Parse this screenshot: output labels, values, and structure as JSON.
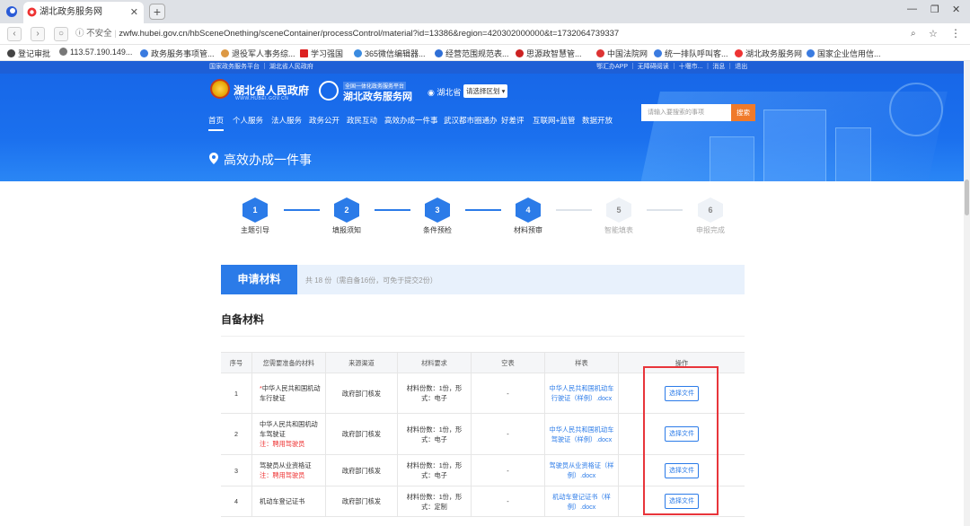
{
  "browser": {
    "tab_title": "湖北政务服务网",
    "address": "zwfw.hubei.gov.cn/hbSceneOnething/sceneContainer/processControl/material?id=13386&region=420302000000&t=1732064739337",
    "security": "不安全",
    "bookmarks": [
      "登记审批",
      "113.57.190.149...",
      "政务服务事项管...",
      "退役军人事务综...",
      "学习强国",
      "365微信编辑器...",
      "经营范围规范表...",
      "思源政智慧管...",
      "中国法院网",
      "统一排队呼叫客...",
      "湖北政务服务网",
      "国家企业信用信..."
    ]
  },
  "site": {
    "top_left": "国家政务服务平台 ｜ 湖北省人民政府",
    "top_right": "鄂汇办APP ｜ 无障碍阅读 ｜ 十堰市... ｜ 消息 ｜ 退出",
    "gov_title": "湖北省人民政府",
    "gov_sub": "WWW.HUBEI.GOV.CN",
    "svc_small": "全国一体化政务服务平台",
    "svc_title": "湖北政务服务网",
    "province": "湖北省",
    "region_select": "请选择区划",
    "nav": [
      "首页",
      "个人服务",
      "法人服务",
      "政务公开",
      "政民互动",
      "高效办成一件事",
      "武汉都市圈通办",
      "好差评",
      "互联网+监管",
      "数据开放"
    ],
    "search_placeholder": "请输入要搜索的事项",
    "search_btn": "搜索",
    "page_heading": "高效办成一件事"
  },
  "steps": [
    {
      "num": "1",
      "label": "主题引导",
      "state": "done"
    },
    {
      "num": "2",
      "label": "填报须知",
      "state": "done"
    },
    {
      "num": "3",
      "label": "条件预检",
      "state": "done"
    },
    {
      "num": "4",
      "label": "材料预审",
      "state": "done"
    },
    {
      "num": "5",
      "label": "智能填表",
      "state": "todo"
    },
    {
      "num": "6",
      "label": "申报完成",
      "state": "todo"
    }
  ],
  "materials": {
    "tab": "申请材料",
    "count": "共 18 份（需自备16份，可免于提交2份）",
    "self_title": "自备材料",
    "headers": [
      "序号",
      "您需要准备的材料",
      "来源渠道",
      "材料要求",
      "空表",
      "样表",
      "操作"
    ],
    "rows": [
      {
        "no": "1",
        "name_star": "*",
        "name": "中华人民共和国机动车行驶证",
        "note": "",
        "source": "政府部门核发",
        "req": "材料份数：1份，形式：电子",
        "blank": "-",
        "sample": "中华人民共和国机动车行驶证（样例）.docx",
        "action": "选择文件"
      },
      {
        "no": "2",
        "name_star": "",
        "name": "中华人民共和国机动车驾驶证",
        "note": "注：聘用驾驶员",
        "source": "政府部门核发",
        "req": "材料份数：1份，形式：电子",
        "blank": "-",
        "sample": "中华人民共和国机动车驾驶证（样例）.docx",
        "action": "选择文件"
      },
      {
        "no": "3",
        "name_star": "",
        "name": "驾驶员从业资格证",
        "note": "注：聘用驾驶员",
        "source": "政府部门核发",
        "req": "材料份数：1份，形式：电子",
        "blank": "-",
        "sample": "驾驶员从业资格证（样例）.docx",
        "action": "选择文件"
      },
      {
        "no": "4",
        "name_star": "",
        "name": "机动车登记证书",
        "note": "",
        "source": "政府部门核发",
        "req": "材料份数：1份，形式：定制",
        "blank": "-",
        "sample": "机动车登记证书（样例）.docx",
        "action": "选择文件"
      }
    ]
  }
}
